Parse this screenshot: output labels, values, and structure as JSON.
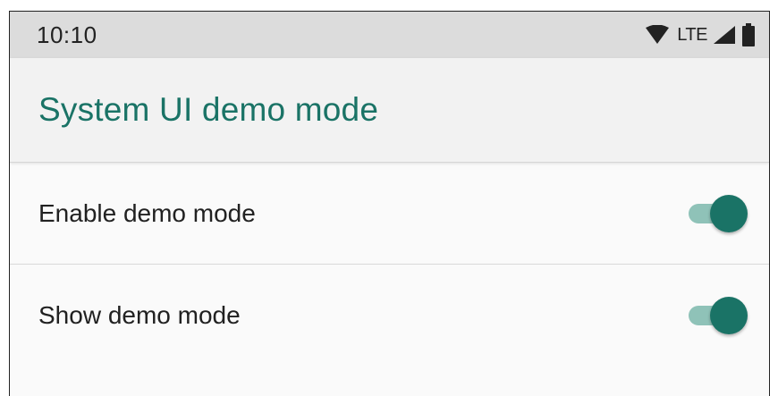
{
  "status_bar": {
    "time": "10:10",
    "network_label": "LTE",
    "icons": [
      "wifi-icon",
      "cell-signal-icon",
      "battery-icon"
    ]
  },
  "app_bar": {
    "title": "System UI demo mode"
  },
  "settings": [
    {
      "label": "Enable demo mode",
      "enabled": true
    },
    {
      "label": "Show demo mode",
      "enabled": true
    }
  ],
  "colors": {
    "accent": "#1a7366",
    "switch_track": "#8fc2b8",
    "status_bar_bg": "#dcdcdc",
    "app_bar_bg": "#f2f2f2",
    "list_bg": "#fafafa"
  }
}
